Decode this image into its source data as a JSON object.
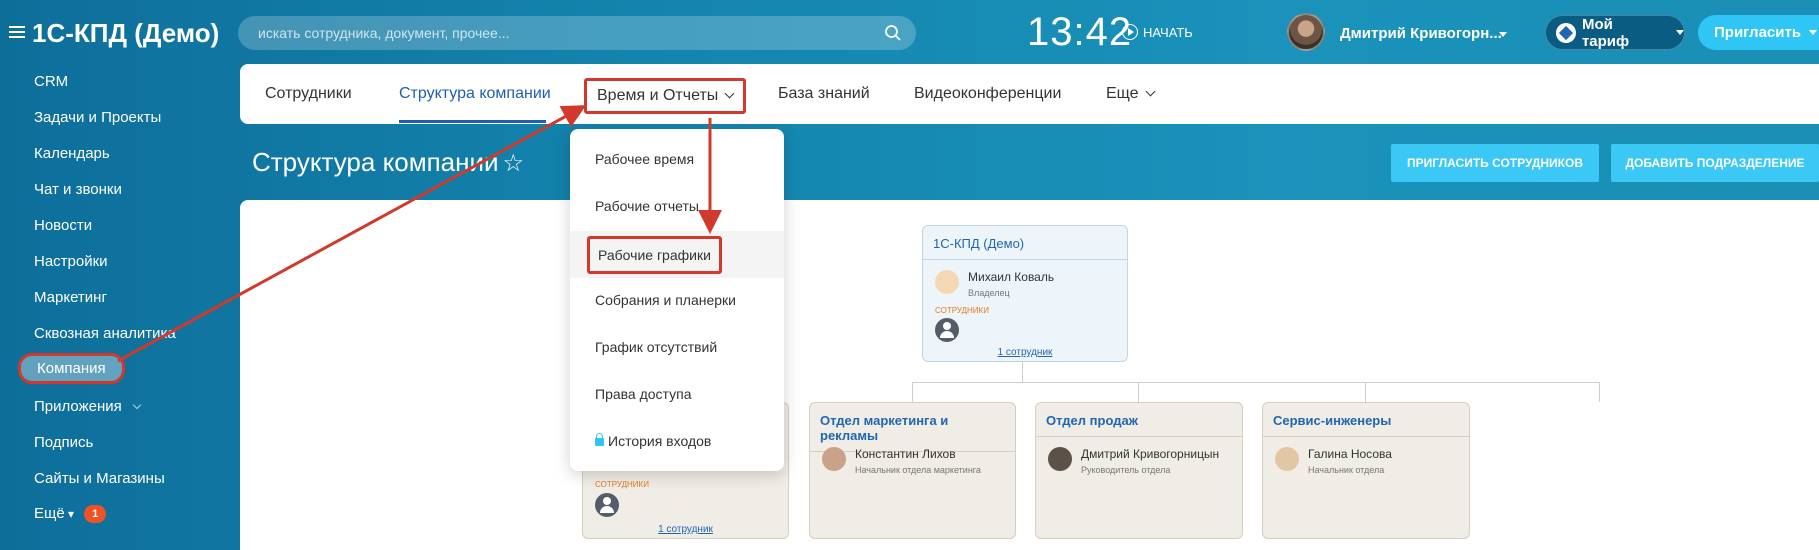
{
  "header": {
    "app_title": "1С-КПД (Демо)",
    "search_placeholder": "искать сотрудника, документ, прочее...",
    "clock": "13:42",
    "start_label": "НАЧАТЬ",
    "user_name": "Дмитрий Кривогорн...",
    "tariff_label": "Мой тариф",
    "invite_label": "Пригласить"
  },
  "sidebar": {
    "items": [
      {
        "label": "CRM"
      },
      {
        "label": "Задачи и Проекты"
      },
      {
        "label": "Календарь"
      },
      {
        "label": "Чат и звонки"
      },
      {
        "label": "Новости"
      },
      {
        "label": "Настройки"
      },
      {
        "label": "Маркетинг"
      },
      {
        "label": "Сквозная аналитика"
      },
      {
        "label": "Компания"
      },
      {
        "label": "Приложения"
      },
      {
        "label": "Подпись"
      },
      {
        "label": "Сайты и Магазины"
      },
      {
        "label": "Ещё"
      }
    ],
    "more_badge": "1"
  },
  "nav": {
    "tabs": [
      {
        "label": "Сотрудники"
      },
      {
        "label": "Структура компании"
      },
      {
        "label": "Время и Отчеты"
      },
      {
        "label": "База знаний"
      },
      {
        "label": "Видеоконференции"
      },
      {
        "label": "Еще"
      }
    ]
  },
  "page": {
    "title": "Структура компании",
    "invite_employees_btn": "ПРИГЛАСИТЬ СОТРУДНИКОВ",
    "add_department_btn": "ДОБАВИТЬ ПОДРАЗДЕЛЕНИЕ"
  },
  "dropdown": {
    "items": [
      {
        "label": "Рабочее время"
      },
      {
        "label": "Рабочие отчеты"
      },
      {
        "label": "Рабочие графики"
      },
      {
        "label": "Собрания и планерки"
      },
      {
        "label": "График отсутствий"
      },
      {
        "label": "Права доступа"
      },
      {
        "label": "История входов"
      }
    ]
  },
  "org": {
    "root": {
      "title": "1С-КПД (Демо)",
      "head_name": "Михаил Коваль",
      "head_role": "Владелец",
      "employees_label": "СОТРУДНИКИ",
      "count_link": "1 сотрудник"
    },
    "first_dept": {
      "employees_label": "СОТРУДНИКИ",
      "count_link": "1 сотрудник"
    },
    "departments": [
      {
        "title": "Отдел маркетинга и рекламы",
        "head_name": "Константин Лихов",
        "head_role": "Начальник отдела маркетинга"
      },
      {
        "title": "Отдел продаж",
        "head_name": "Дмитрий Кривогорницын",
        "head_role": "Руководитель отдела"
      },
      {
        "title": "Сервис-инженеры",
        "head_name": "Галина Носова",
        "head_role": "Начальник отдела"
      }
    ]
  },
  "colors": {
    "accent": "#1f5eb0",
    "highlight_box": "#d0392b",
    "button_light": "#3cc8f5",
    "badge": "#f05228"
  },
  "icons": [
    "menu-icon",
    "search-icon",
    "play-icon",
    "chevron-down-icon",
    "tariff-icon",
    "star-icon",
    "lock-icon",
    "user-placeholder-icon"
  ]
}
